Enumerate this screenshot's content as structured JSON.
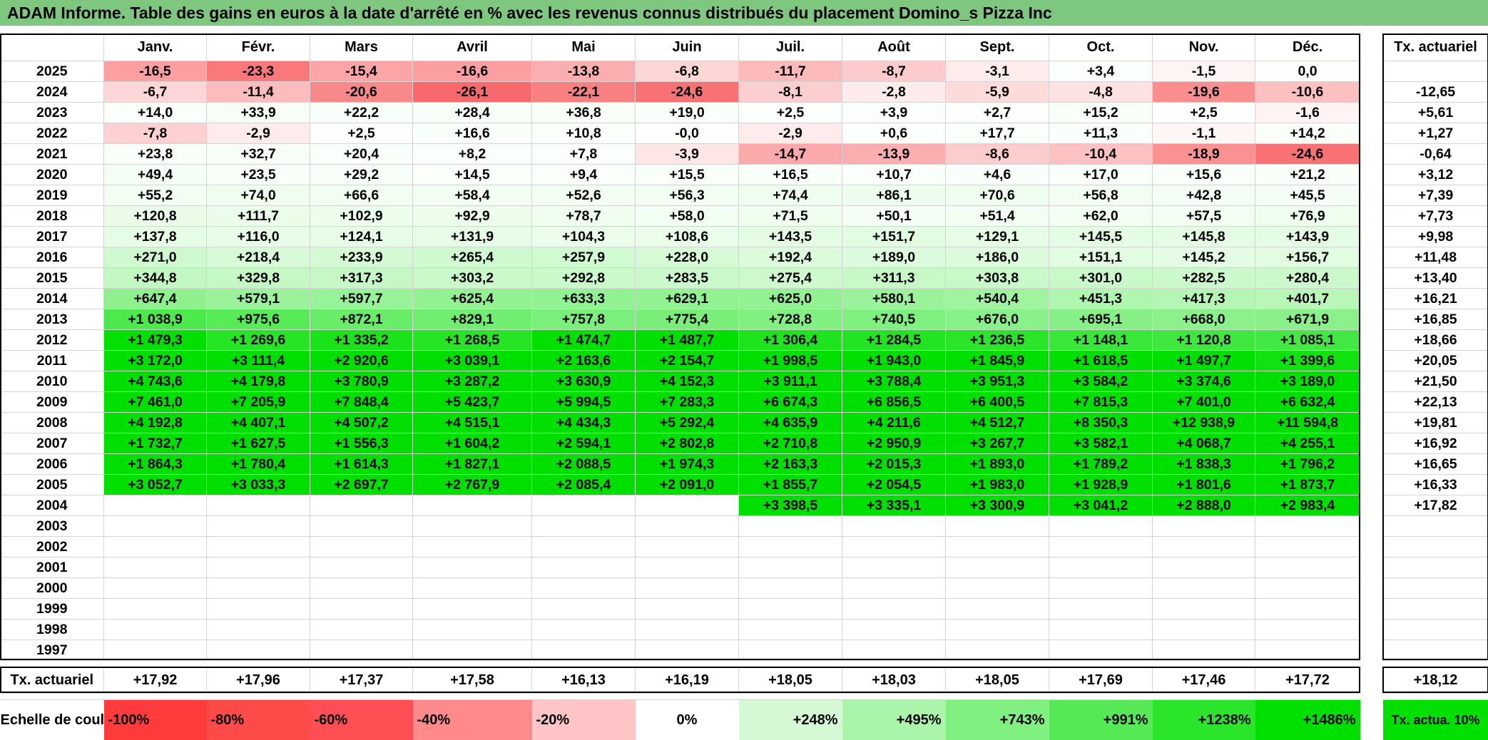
{
  "title": "ADAM Informe. Table des gains en euros à la date d'arrêté en % avec les revenus connus distribués du placement Domino_s Pizza Inc",
  "months": [
    "Janv.",
    "Févr.",
    "Mars",
    "Avril",
    "Mai",
    "Juin",
    "Juil.",
    "Août",
    "Sept.",
    "Oct.",
    "Nov.",
    "Déc."
  ],
  "side_header": "Tx. actuariel",
  "rows": [
    {
      "year": "2025",
      "values": [
        "-16,5",
        "-23,3",
        "-15,4",
        "-16,6",
        "-13,8",
        "-6,8",
        "-11,7",
        "-8,7",
        "-3,1",
        "+3,4",
        "-1,5",
        "0,0"
      ],
      "tx": ""
    },
    {
      "year": "2024",
      "values": [
        "-6,7",
        "-11,4",
        "-20,6",
        "-26,1",
        "-22,1",
        "-24,6",
        "-8,1",
        "-2,8",
        "-5,9",
        "-4,8",
        "-19,6",
        "-10,6"
      ],
      "tx": "-12,65"
    },
    {
      "year": "2023",
      "values": [
        "+14,0",
        "+33,9",
        "+22,2",
        "+28,4",
        "+36,8",
        "+19,0",
        "+2,5",
        "+3,9",
        "+2,7",
        "+15,2",
        "+2,5",
        "-1,6"
      ],
      "tx": "+5,61"
    },
    {
      "year": "2022",
      "values": [
        "-7,8",
        "-2,9",
        "+2,5",
        "+16,6",
        "+10,8",
        "-0,0",
        "-2,9",
        "+0,6",
        "+17,7",
        "+11,3",
        "-1,1",
        "+14,2"
      ],
      "tx": "+1,27"
    },
    {
      "year": "2021",
      "values": [
        "+23,8",
        "+32,7",
        "+20,4",
        "+8,2",
        "+7,8",
        "-3,9",
        "-14,7",
        "-13,9",
        "-8,6",
        "-10,4",
        "-18,9",
        "-24,6"
      ],
      "tx": "-0,64"
    },
    {
      "year": "2020",
      "values": [
        "+49,4",
        "+23,5",
        "+29,2",
        "+14,5",
        "+9,4",
        "+15,5",
        "+16,5",
        "+10,7",
        "+4,6",
        "+17,0",
        "+15,6",
        "+21,2"
      ],
      "tx": "+3,12"
    },
    {
      "year": "2019",
      "values": [
        "+55,2",
        "+74,0",
        "+66,6",
        "+58,4",
        "+52,6",
        "+56,3",
        "+74,4",
        "+86,1",
        "+70,6",
        "+56,8",
        "+42,8",
        "+45,5"
      ],
      "tx": "+7,39"
    },
    {
      "year": "2018",
      "values": [
        "+120,8",
        "+111,7",
        "+102,9",
        "+92,9",
        "+78,7",
        "+58,0",
        "+71,5",
        "+50,1",
        "+51,4",
        "+62,0",
        "+57,5",
        "+76,9"
      ],
      "tx": "+7,73"
    },
    {
      "year": "2017",
      "values": [
        "+137,8",
        "+116,0",
        "+124,1",
        "+131,9",
        "+104,3",
        "+108,6",
        "+143,5",
        "+151,7",
        "+129,1",
        "+145,5",
        "+145,8",
        "+143,9"
      ],
      "tx": "+9,98"
    },
    {
      "year": "2016",
      "values": [
        "+271,0",
        "+218,4",
        "+233,9",
        "+265,4",
        "+257,9",
        "+228,0",
        "+192,4",
        "+189,0",
        "+186,0",
        "+151,1",
        "+145,2",
        "+156,7"
      ],
      "tx": "+11,48"
    },
    {
      "year": "2015",
      "values": [
        "+344,8",
        "+329,8",
        "+317,3",
        "+303,2",
        "+292,8",
        "+283,5",
        "+275,4",
        "+311,3",
        "+303,8",
        "+301,0",
        "+282,5",
        "+280,4"
      ],
      "tx": "+13,40"
    },
    {
      "year": "2014",
      "values": [
        "+647,4",
        "+579,1",
        "+597,7",
        "+625,4",
        "+633,3",
        "+629,1",
        "+625,0",
        "+580,1",
        "+540,4",
        "+451,3",
        "+417,3",
        "+401,7"
      ],
      "tx": "+16,21"
    },
    {
      "year": "2013",
      "values": [
        "+1 038,9",
        "+975,6",
        "+872,1",
        "+829,1",
        "+757,8",
        "+775,4",
        "+728,8",
        "+740,5",
        "+676,0",
        "+695,1",
        "+668,0",
        "+671,9"
      ],
      "tx": "+16,85"
    },
    {
      "year": "2012",
      "values": [
        "+1 479,3",
        "+1 269,6",
        "+1 335,2",
        "+1 268,5",
        "+1 474,7",
        "+1 487,7",
        "+1 306,4",
        "+1 284,5",
        "+1 236,5",
        "+1 148,1",
        "+1 120,8",
        "+1 085,1"
      ],
      "tx": "+18,66"
    },
    {
      "year": "2011",
      "values": [
        "+3 172,0",
        "+3 111,4",
        "+2 920,6",
        "+3 039,1",
        "+2 163,6",
        "+2 154,7",
        "+1 998,5",
        "+1 943,0",
        "+1 845,9",
        "+1 618,5",
        "+1 497,7",
        "+1 399,6"
      ],
      "tx": "+20,05"
    },
    {
      "year": "2010",
      "values": [
        "+4 743,6",
        "+4 179,8",
        "+3 780,9",
        "+3 287,2",
        "+3 630,9",
        "+4 152,3",
        "+3 911,1",
        "+3 788,4",
        "+3 951,3",
        "+3 584,2",
        "+3 374,6",
        "+3 189,0"
      ],
      "tx": "+21,50"
    },
    {
      "year": "2009",
      "values": [
        "+7 461,0",
        "+7 205,9",
        "+7 848,4",
        "+5 423,7",
        "+5 994,5",
        "+7 283,3",
        "+6 674,3",
        "+6 856,5",
        "+6 400,5",
        "+7 815,3",
        "+7 401,0",
        "+6 632,4"
      ],
      "tx": "+22,13"
    },
    {
      "year": "2008",
      "values": [
        "+4 192,8",
        "+4 407,1",
        "+4 507,2",
        "+4 515,1",
        "+4 434,3",
        "+5 292,4",
        "+4 635,9",
        "+4 211,6",
        "+4 512,7",
        "+8 350,3",
        "+12 938,9",
        "+11 594,8"
      ],
      "tx": "+19,81"
    },
    {
      "year": "2007",
      "values": [
        "+1 732,7",
        "+1 627,5",
        "+1 556,3",
        "+1 604,2",
        "+2 594,1",
        "+2 802,8",
        "+2 710,8",
        "+2 950,9",
        "+3 267,7",
        "+3 582,1",
        "+4 068,7",
        "+4 255,1"
      ],
      "tx": "+16,92"
    },
    {
      "year": "2006",
      "values": [
        "+1 864,3",
        "+1 780,4",
        "+1 614,3",
        "+1 827,1",
        "+2 088,5",
        "+1 974,3",
        "+2 163,3",
        "+2 015,3",
        "+1 893,0",
        "+1 789,2",
        "+1 838,3",
        "+1 796,2"
      ],
      "tx": "+16,65"
    },
    {
      "year": "2005",
      "values": [
        "+3 052,7",
        "+3 033,3",
        "+2 697,7",
        "+2 767,9",
        "+2 085,4",
        "+2 091,0",
        "+1 855,7",
        "+2 054,5",
        "+1 983,0",
        "+1 928,9",
        "+1 801,6",
        "+1 873,7"
      ],
      "tx": "+16,33"
    },
    {
      "year": "2004",
      "values": [
        "",
        "",
        "",
        "",
        "",
        "",
        "+3 398,5",
        "+3 335,1",
        "+3 300,9",
        "+3 041,2",
        "+2 888,0",
        "+2 983,4"
      ],
      "tx": "+17,82"
    },
    {
      "year": "2003",
      "values": [
        "",
        "",
        "",
        "",
        "",
        "",
        "",
        "",
        "",
        "",
        "",
        ""
      ],
      "tx": ""
    },
    {
      "year": "2002",
      "values": [
        "",
        "",
        "",
        "",
        "",
        "",
        "",
        "",
        "",
        "",
        "",
        ""
      ],
      "tx": ""
    },
    {
      "year": "2001",
      "values": [
        "",
        "",
        "",
        "",
        "",
        "",
        "",
        "",
        "",
        "",
        "",
        ""
      ],
      "tx": ""
    },
    {
      "year": "2000",
      "values": [
        "",
        "",
        "",
        "",
        "",
        "",
        "",
        "",
        "",
        "",
        "",
        ""
      ],
      "tx": ""
    },
    {
      "year": "1999",
      "values": [
        "",
        "",
        "",
        "",
        "",
        "",
        "",
        "",
        "",
        "",
        "",
        ""
      ],
      "tx": ""
    },
    {
      "year": "1998",
      "values": [
        "",
        "",
        "",
        "",
        "",
        "",
        "",
        "",
        "",
        "",
        "",
        ""
      ],
      "tx": ""
    },
    {
      "year": "1997",
      "values": [
        "",
        "",
        "",
        "",
        "",
        "",
        "",
        "",
        "",
        "",
        "",
        ""
      ],
      "tx": ""
    }
  ],
  "footer": {
    "label": "Tx. actuariel",
    "values": [
      "+17,92",
      "+17,96",
      "+17,37",
      "+17,58",
      "+16,13",
      "+16,19",
      "+18,05",
      "+18,03",
      "+18,05",
      "+17,69",
      "+17,46",
      "+17,72"
    ],
    "overall": "+18,12"
  },
  "scale": {
    "label": "Echelle de couleur",
    "items": [
      {
        "label": "-100%",
        "color": "#ff3b3b"
      },
      {
        "label": "-80%",
        "color": "#ff4a4a"
      },
      {
        "label": "-60%",
        "color": "#ff4f55"
      },
      {
        "label": "-40%",
        "color": "#ff8a8c"
      },
      {
        "label": "-20%",
        "color": "#ffc5c6"
      },
      {
        "label": "0%",
        "color": "#ffffff"
      },
      {
        "label": "+248%",
        "color": "#d5f9d5"
      },
      {
        "label": "+495%",
        "color": "#aaf5aa"
      },
      {
        "label": "+743%",
        "color": "#80f080"
      },
      {
        "label": "+991%",
        "color": "#55ea55"
      },
      {
        "label": "+1238%",
        "color": "#2be52b"
      },
      {
        "label": "+1486%",
        "color": "#00e000"
      }
    ],
    "side_label": "Tx. actua. 10%",
    "side_color": "#00e000"
  },
  "colors": {
    "title_bg": "#7ec77e",
    "negative_max": "#f8696b",
    "positive_max": "#00e000"
  }
}
